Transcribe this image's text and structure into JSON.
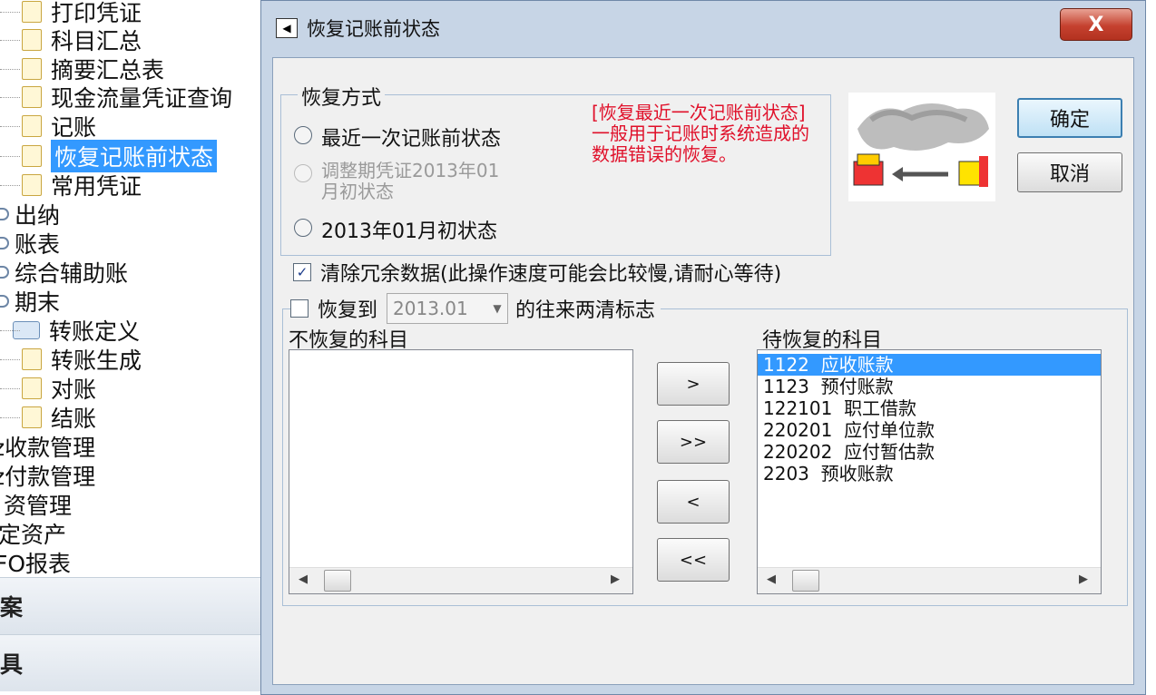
{
  "tree": {
    "items": [
      {
        "label": "打印凭证"
      },
      {
        "label": "科目汇总"
      },
      {
        "label": "摘要汇总表"
      },
      {
        "label": "现金流量凭证查询"
      },
      {
        "label": "记账"
      },
      {
        "label": "恢复记账前状态"
      },
      {
        "label": "常用凭证"
      },
      {
        "label": "出纳"
      },
      {
        "label": "账表"
      },
      {
        "label": "综合辅助账"
      },
      {
        "label": "期末"
      },
      {
        "label": "转账定义"
      },
      {
        "label": "转账生成"
      },
      {
        "label": "对账"
      },
      {
        "label": "结账"
      },
      {
        "label": "z收款管理"
      },
      {
        "label": "z付款管理"
      },
      {
        "label": "资管理"
      },
      {
        "label": "定资产"
      },
      {
        "label": "FO报表"
      }
    ],
    "nav": [
      "案",
      "具"
    ]
  },
  "dialog": {
    "title": "恢复记账前状态",
    "close_label": "X",
    "restore_mode": {
      "legend": "恢复方式",
      "options": [
        {
          "label": "最近一次记账前状态"
        },
        {
          "label": "调整期凭证2013年01\n月初状态"
        },
        {
          "label": "2013年01月初状态"
        }
      ],
      "note": "[恢复最近一次记账前状态]一般用于记账时系统造成的数据错误的恢复。"
    },
    "ok_label": "确定",
    "cancel_label": "取消",
    "clear_redundant": {
      "label": "清除冗余数据(此操作速度可能会比较慢,请耐心等待)",
      "checked": true,
      "mark": "✓"
    },
    "restore_to": {
      "prefix": "恢复到",
      "period": "2013.01",
      "suffix": "的往来两清标志",
      "checked": false
    },
    "no_restore_label": "不恢复的科目",
    "to_restore_label": "待恢复的科目",
    "move_buttons": [
      ">",
      ">>",
      "<",
      "<<"
    ],
    "to_restore_items": [
      {
        "text": "1122  应收账款"
      },
      {
        "text": "1123  预付账款"
      },
      {
        "text": "122101  职工借款"
      },
      {
        "text": "220201  应付单位款"
      },
      {
        "text": "220202  应付暂估款"
      },
      {
        "text": "2203  预收账款"
      }
    ],
    "scroll_left": "◀",
    "scroll_right": "▶"
  }
}
